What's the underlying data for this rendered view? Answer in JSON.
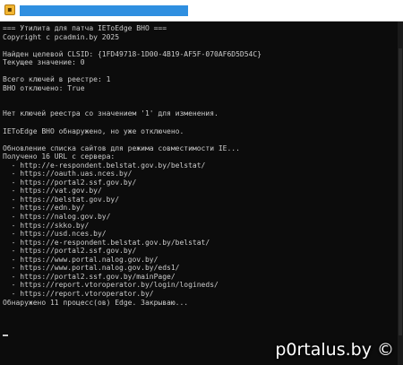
{
  "window": {
    "icon": "console-app-icon"
  },
  "console": {
    "lines": [
      "=== Утилита для патча IEToEdge BHO ===",
      "Copyright c pcadmin.by 2025",
      "",
      "Найден целевой CLSID: {1FD49718-1D00-4B19-AF5F-070AF6D5D54C}",
      "Текущее значение: 0",
      "",
      "Всего ключей в реестре: 1",
      "BHO отключено: True",
      "",
      "",
      "Нет ключей реестра со значением '1' для изменения.",
      "",
      "IEToEdge BHO обнаружено, но уже отключено.",
      "",
      "Обновление списка сайтов для режима совместимости IE...",
      "Получено 16 URL с сервера:",
      "  - http://e-respondent.belstat.gov.by/belstat/",
      "  - https://oauth.uas.nces.by/",
      "  - https://portal2.ssf.gov.by/",
      "  - https://vat.gov.by/",
      "  - https://belstat.gov.by/",
      "  - https://edn.by/",
      "  - https://nalog.gov.by/",
      "  - https://skko.by/",
      "  - https://usd.nces.by/",
      "  - https://e-respondent.belstat.gov.by/belstat/",
      "  - https://portal2.ssf.gov.by/",
      "  - https://www.portal.nalog.gov.by/",
      "  - https://www.portal.nalog.gov.by/eds1/",
      "  - https://portal2.ssf.gov.by/mainPage/",
      "  - https://report.vtoroperator.by/login/logineds/",
      "  - https://report.vtoroperator.by/",
      "Обнаружено 11 процесс(ов) Edge. Закрываю..."
    ]
  },
  "watermark": {
    "text": "p0rtalus.by ©"
  }
}
